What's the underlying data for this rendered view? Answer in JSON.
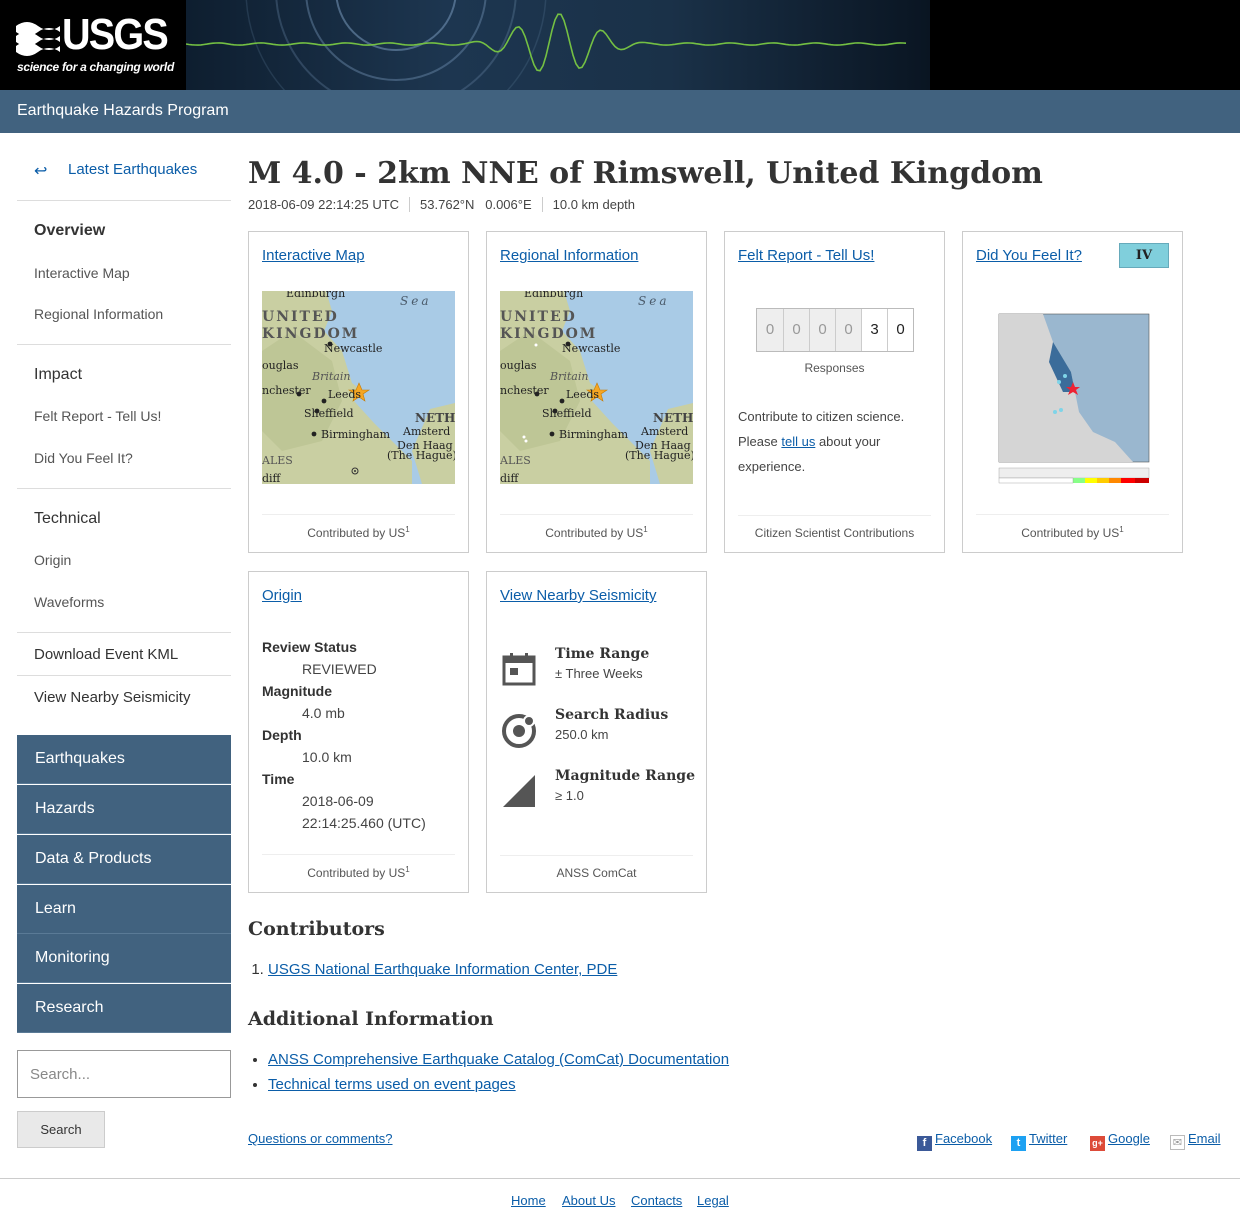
{
  "header": {
    "logo_text": "USGS",
    "tagline": "science for a changing world",
    "program": "Earthquake Hazards Program"
  },
  "sidebar": {
    "back_label": "Latest Earthquakes",
    "overview": "Overview",
    "links_overview": [
      "Interactive Map",
      "Regional Information"
    ],
    "impact": "Impact",
    "links_impact": [
      "Felt Report - Tell Us!",
      "Did You Feel It?"
    ],
    "technical": "Technical",
    "links_technical": [
      "Origin",
      "Waveforms"
    ],
    "download_kml": "Download Event KML",
    "nearby": "View Nearby Seismicity",
    "nav": [
      "Earthquakes",
      "Hazards",
      "Data & Products",
      "Learn",
      "Monitoring",
      "Research"
    ],
    "search_placeholder": "Search...",
    "search_button": "Search"
  },
  "event": {
    "title": "M 4.0 - 2km NNE of Rimswell, United Kingdom",
    "time": "2018-06-09 22:14:25 UTC",
    "coords": "53.762°N   0.006°E",
    "depth": "10.0 km depth"
  },
  "cards": {
    "interactive_map": {
      "title": "Interactive Map",
      "foot": "Contributed by US"
    },
    "regional": {
      "title": "Regional Information",
      "foot": "Contributed by US"
    },
    "felt": {
      "title": "Felt Report - Tell Us!",
      "digits": [
        "0",
        "0",
        "0",
        "0",
        "3",
        "0"
      ],
      "responses": "Responses",
      "text_before": "Contribute to citizen science. Please ",
      "link": "tell us",
      "text_after": " about your experience.",
      "foot": "Citizen Scientist Contributions"
    },
    "dyfi": {
      "title": "Did You Feel It?",
      "badge": "IV",
      "foot": "Contributed by US"
    },
    "origin": {
      "title": "Origin",
      "review_label": "Review Status",
      "review_value": "REVIEWED",
      "mag_label": "Magnitude",
      "mag_value": "4.0 mb",
      "depth_label": "Depth",
      "depth_value": "10.0 km",
      "time_label": "Time",
      "time_value_1": "2018-06-09",
      "time_value_2": "22:14:25.460 (UTC)",
      "foot": "Contributed by US"
    },
    "seismicity": {
      "title": "View Nearby Seismicity",
      "time_label": "Time Range",
      "time_value": "± Three Weeks",
      "radius_label": "Search Radius",
      "radius_value": "250.0 km",
      "mag_label": "Magnitude Range",
      "mag_value": "≥ 1.0",
      "foot": "ANSS ComCat"
    },
    "sup": "1"
  },
  "map_labels": {
    "edinburgh": "Edinburgh",
    "sea": "Sea",
    "united": "UNITED",
    "kingdom": "KINGDOM",
    "newcastle": "Newcastle",
    "douglas": "ouglas",
    "britain": "Britain",
    "manchester": "nchester",
    "leeds": "Leeds",
    "sheffield": "Sheffield",
    "neth": "NETH",
    "birmingham": "Birmingham",
    "amsterd": "Amsterd",
    "denhaag": "Den Haag",
    "thehague": "(The Hague)",
    "ales": "ALES",
    "diff": "diff"
  },
  "contributors": {
    "heading": "Contributors",
    "items": [
      "USGS National Earthquake Information Center, PDE"
    ]
  },
  "additional": {
    "heading": "Additional Information",
    "items": [
      "ANSS Comprehensive Earthquake Catalog (ComCat) Documentation",
      "Technical terms used on event pages"
    ]
  },
  "footer": {
    "questions": "Questions or comments?",
    "share": [
      "Facebook",
      "Twitter",
      "Google",
      "Email"
    ],
    "links": [
      "Home",
      "About Us",
      "Contacts",
      "Legal"
    ]
  },
  "colors": {
    "header_bar": "#41627f",
    "link": "#0b5da8",
    "mmi_iv": "#80cfdc"
  }
}
